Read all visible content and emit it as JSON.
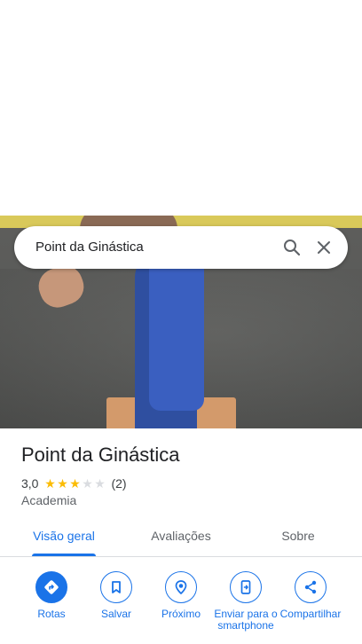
{
  "search": {
    "query": "Point da Ginástica"
  },
  "place": {
    "name": "Point da Ginástica",
    "rating": "3,0",
    "rating_value": 3,
    "rating_max": 5,
    "review_count": "(2)",
    "category": "Academia"
  },
  "tabs": [
    {
      "label": "Visão geral",
      "active": true
    },
    {
      "label": "Avaliações",
      "active": false
    },
    {
      "label": "Sobre",
      "active": false
    }
  ],
  "actions": [
    {
      "label": "Rotas",
      "icon": "directions-icon"
    },
    {
      "label": "Salvar",
      "icon": "bookmark-icon"
    },
    {
      "label": "Próximo",
      "icon": "nearby-icon"
    },
    {
      "label": "Enviar para o smartphone",
      "icon": "send-to-phone-icon"
    },
    {
      "label": "Compartilhar",
      "icon": "share-icon"
    }
  ],
  "colors": {
    "accent": "#1a73e8",
    "star": "#fbbc04"
  }
}
